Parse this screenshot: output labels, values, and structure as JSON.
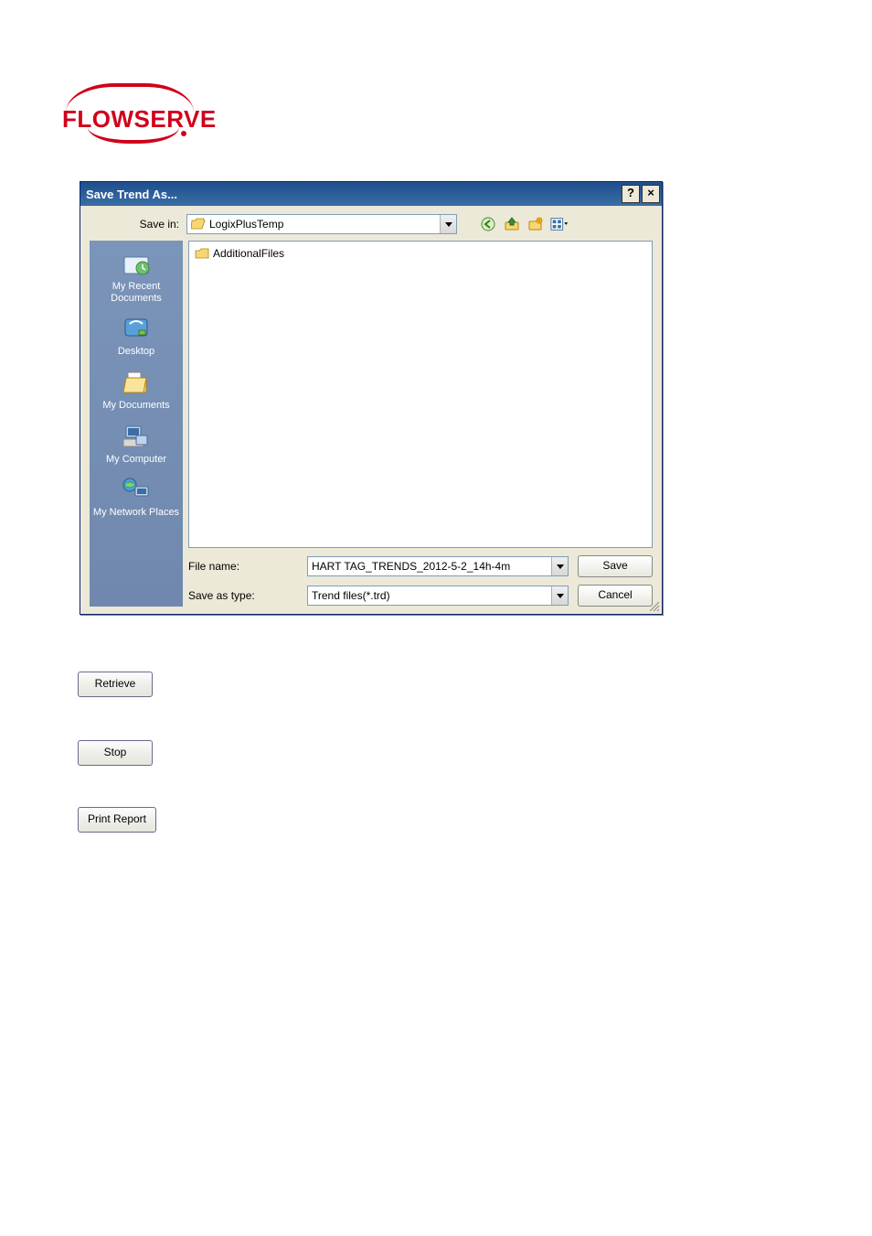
{
  "brand": {
    "name": "FLOWSERVE"
  },
  "dialog": {
    "title": "Save Trend As...",
    "save_in_label": "Save in:",
    "location": "LogixPlusTemp",
    "folder_contents": [
      "AdditionalFiles"
    ],
    "places": [
      "My Recent Documents",
      "Desktop",
      "My Documents",
      "My Computer",
      "My Network Places"
    ],
    "file_name_label": "File name:",
    "file_name_value": "HART TAG_TRENDS_2012-5-2_14h-4m",
    "save_as_type_label": "Save as type:",
    "save_as_type_value": "Trend files(*.trd)",
    "save_button": "Save",
    "cancel_button": "Cancel"
  },
  "buttons": {
    "retrieve": "Retrieve",
    "stop": "Stop",
    "print_report": "Print Report"
  }
}
